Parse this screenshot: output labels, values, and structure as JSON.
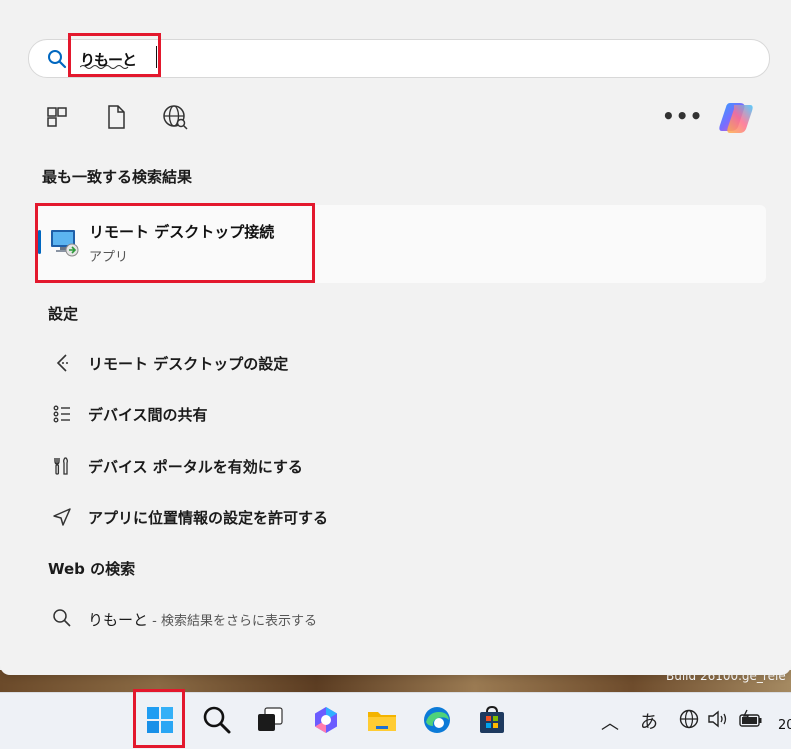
{
  "search": {
    "query": "りもーと"
  },
  "best_match": {
    "section_title": "最も一致する検索結果",
    "app_name": "リモート デスクトップ接続",
    "app_type": "アプリ"
  },
  "settings": {
    "section_title": "設定",
    "items": [
      {
        "label": "リモート デスクトップの設定",
        "icon": "remote-desktop-settings-icon"
      },
      {
        "label": "デバイス間の共有",
        "icon": "list-share-icon"
      },
      {
        "label": "デバイス ポータルを有効にする",
        "icon": "tools-icon"
      },
      {
        "label": "アプリに位置情報の設定を許可する",
        "icon": "location-arrow-icon"
      }
    ]
  },
  "web": {
    "section_title": "Web の検索",
    "query": "りもーと",
    "hint": " - 検索結果をさらに表示する"
  },
  "desktop": {
    "build_text": "Build 26100.ge_rele"
  },
  "taskbar": {
    "ime_label": "あ",
    "clock_partial": "20"
  },
  "colors": {
    "highlight_red": "#e3182d",
    "accent_blue": "#0067c0",
    "panel_bg": "#f2f2f2"
  }
}
